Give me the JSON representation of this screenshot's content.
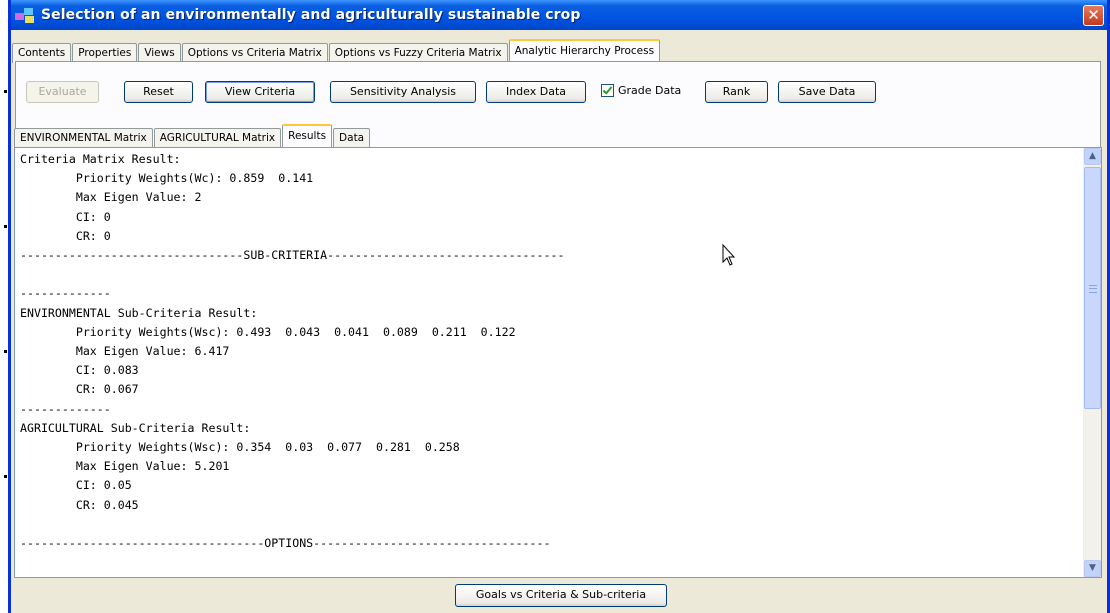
{
  "window": {
    "title": "Selection of an environmentally and agriculturally sustainable crop",
    "close_glyph": "✕",
    "accent_color": "#0054e3"
  },
  "main_tabs": [
    {
      "label": "Contents"
    },
    {
      "label": "Properties"
    },
    {
      "label": "Views"
    },
    {
      "label": "Options vs Criteria Matrix"
    },
    {
      "label": "Options vs Fuzzy Criteria Matrix"
    },
    {
      "label": "Analytic Hierarchy Process",
      "active": true
    }
  ],
  "toolbar": {
    "evaluate": "Evaluate",
    "reset": "Reset",
    "view_criteria": "View Criteria",
    "sensitivity_analysis": "Sensitivity Analysis",
    "index_data": "Index Data",
    "grade_data": "Grade Data",
    "grade_data_checked": true,
    "rank": "Rank",
    "save_data": "Save Data"
  },
  "sub_tabs": [
    {
      "label": "ENVIRONMENTAL Matrix"
    },
    {
      "label": "AGRICULTURAL Matrix"
    },
    {
      "label": "Results",
      "active": true
    },
    {
      "label": "Data"
    }
  ],
  "results_text": "Criteria Matrix Result:\n        Priority Weights(Wc): 0.859  0.141\n        Max Eigen Value: 2\n        CI: 0\n        CR: 0\n--------------------------------SUB-CRITERIA----------------------------------\n\n-------------\nENVIRONMENTAL Sub-Criteria Result:\n        Priority Weights(Wsc): 0.493  0.043  0.041  0.089  0.211  0.122\n        Max Eigen Value: 6.417\n        CI: 0.083\n        CR: 0.067\n-------------\nAGRICULTURAL Sub-Criteria Result:\n        Priority Weights(Wsc): 0.354  0.03  0.077  0.281  0.258\n        Max Eigen Value: 5.201\n        CI: 0.05\n        CR: 0.045\n\n-----------------------------------OPTIONS----------------------------------",
  "scroll_up_glyph": "▲",
  "scroll_down_glyph": "▼",
  "footer": {
    "goals_button": "Goals vs Criteria & Sub-criteria"
  }
}
